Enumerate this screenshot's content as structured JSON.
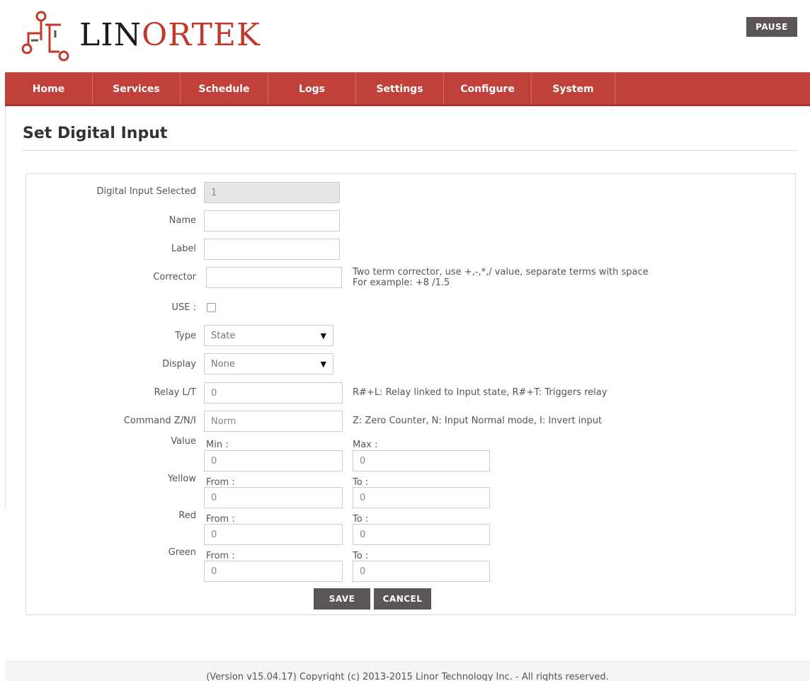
{
  "header": {
    "logo_text_1": "LIN",
    "logo_text_2": "ORTEK",
    "pause_label": "PAUSE",
    "accent_color": "#c0403a",
    "logo_icon": "circuit-logo-icon"
  },
  "nav": {
    "items": [
      {
        "label": "Home"
      },
      {
        "label": "Services"
      },
      {
        "label": "Schedule"
      },
      {
        "label": "Logs"
      },
      {
        "label": "Settings"
      },
      {
        "label": "Configure"
      },
      {
        "label": "System"
      }
    ]
  },
  "page": {
    "title": "Set Digital Input"
  },
  "form": {
    "digital_input_selected": {
      "label": "Digital Input Selected",
      "value": "1"
    },
    "name": {
      "label": "Name",
      "value": ""
    },
    "label": {
      "label": "Label",
      "value": ""
    },
    "corrector": {
      "label": "Corrector",
      "value": "",
      "help_line1": "Two term corrector, use +,-,*,/ value, separate terms with space",
      "help_line2": "For example: +8 /1.5"
    },
    "use": {
      "label": "USE :",
      "checked": false
    },
    "type": {
      "label": "Type",
      "selected": "State"
    },
    "display": {
      "label": "Display",
      "selected": "None"
    },
    "relay": {
      "label": "Relay L/T",
      "value": "0",
      "help": "R#+L: Relay linked to Input state, R#+T: Triggers relay"
    },
    "command": {
      "label": "Command Z/N/I",
      "value": "Norm",
      "help": "Z: Zero Counter, N: Input Normal mode, I: Invert input"
    },
    "value_range": {
      "label": "Value",
      "min_label": "Min :",
      "min": "0",
      "max_label": "Max :",
      "max": "0"
    },
    "yellow": {
      "label": "Yellow",
      "from_label": "From :",
      "from": "0",
      "to_label": "To :",
      "to": "0"
    },
    "red": {
      "label": "Red",
      "from_label": "From :",
      "from": "0",
      "to_label": "To :",
      "to": "0"
    },
    "green": {
      "label": "Green",
      "from_label": "From :",
      "from": "0",
      "to_label": "To :",
      "to": "0"
    },
    "save_label": "SAVE",
    "cancel_label": "CANCEL"
  },
  "footer": {
    "text": "(Version v15.04.17) Copyright (c) 2013-2015 Linor Technology Inc. - All rights reserved."
  }
}
